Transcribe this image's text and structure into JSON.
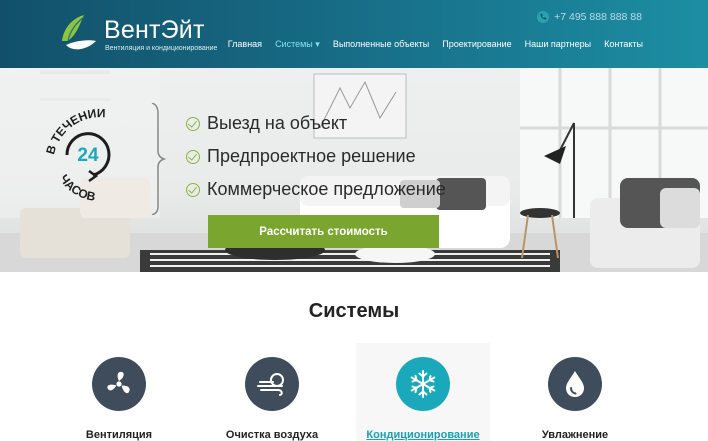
{
  "brand": {
    "name": "ВентЭйт",
    "tagline": "Вентиляция и кондиционирование"
  },
  "header": {
    "phone": "+7 495 888 888 88",
    "nav": [
      {
        "label": "Главная",
        "active": false
      },
      {
        "label": "Системы",
        "active": true,
        "has_dropdown": true
      },
      {
        "label": "Выполненные объекты",
        "active": false
      },
      {
        "label": "Проектирование",
        "active": false
      },
      {
        "label": "Наши партнеры",
        "active": false
      },
      {
        "label": "Контакты",
        "active": false
      }
    ]
  },
  "hero": {
    "badge": {
      "top_text": "В ТЕЧЕНИИ",
      "number": "24",
      "bottom_text": "ЧАСОВ"
    },
    "features": [
      "Выезд на объект",
      "Предпроектное решение",
      "Коммерческое предложение"
    ],
    "cta_label": "Рассчитать стоимость"
  },
  "systems": {
    "title": "Системы",
    "items": [
      {
        "label": "Вентиляция",
        "icon": "fan-icon",
        "selected": false
      },
      {
        "label": "Очистка воздуха",
        "icon": "air-clean-icon",
        "selected": false
      },
      {
        "label": "Кондиционирование",
        "icon": "snowflake-icon",
        "selected": true
      },
      {
        "label": "Увлажнение",
        "icon": "droplet-icon",
        "selected": false
      }
    ]
  },
  "colors": {
    "header_start": "#12506a",
    "header_end": "#1c8ea3",
    "accent_green": "#7aa62f",
    "accent_teal": "#1aa9ba",
    "icon_dark": "#3f4c5c"
  }
}
